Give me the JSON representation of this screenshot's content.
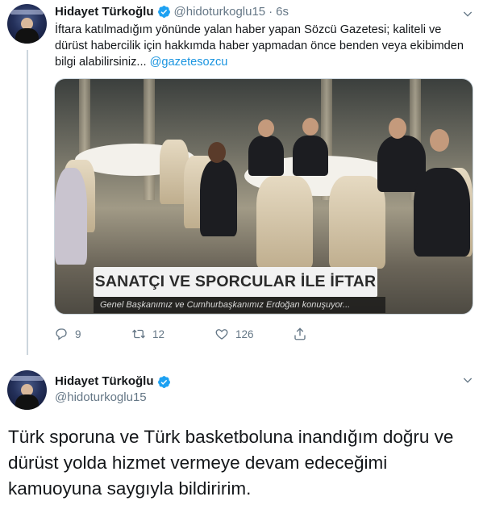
{
  "tweets": [
    {
      "author_name": "Hidayet Türkoğlu",
      "handle": "@hidoturkoglu15",
      "separator": "·",
      "time": "6s",
      "text_main": "İftara katılmadığım yönünde yalan haber yapan Sözcü Gazetesi; kaliteli ve dürüst habercilik için hakkımda haber yapmadan önce benden veya ekibimden bilgi alabilirsiniz... ",
      "text_mention": "@gazetesozcu",
      "media": {
        "caption": "SANATÇI VE SPORCULAR İLE İFTAR",
        "subcaption": "Genel Başkanımız ve Cumhurbaşkanımız Erdoğan konuşuyor..."
      },
      "actions": {
        "replies": "9",
        "retweets": "12",
        "likes": "126"
      }
    },
    {
      "author_name": "Hidayet Türkoğlu",
      "handle": "@hidoturkoglu15",
      "text": "Türk sporuna ve Türk basketboluna inandığım doğru ve dürüst yolda hizmet vermeye devam edeceğimi kamuoyuna saygıyla bildiririm."
    }
  ],
  "icons": {
    "verified": "verified-badge-icon",
    "caret": "chevron-down-icon",
    "reply": "reply-icon",
    "retweet": "retweet-icon",
    "like": "heart-icon",
    "share": "share-icon"
  },
  "colors": {
    "verified": "#1da1f2",
    "mention": "#1b95e0",
    "muted": "#657786",
    "thread_line": "#ccd6dd"
  }
}
